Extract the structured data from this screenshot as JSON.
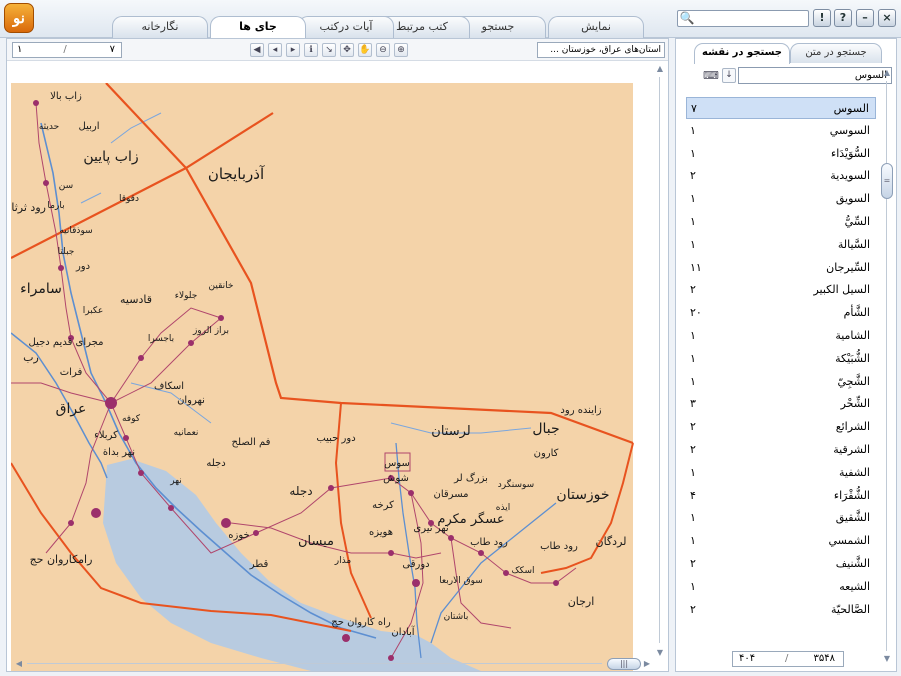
{
  "tabs": [
    {
      "label": "نمایش",
      "active": false
    },
    {
      "label": "جستجو",
      "active": false
    },
    {
      "label": "کتب مرتبط",
      "active": false
    },
    {
      "label": "آیات درکتب",
      "active": false
    },
    {
      "label": "جای ها",
      "active": true
    },
    {
      "label": "نگارخانه",
      "active": false
    }
  ],
  "window_buttons": {
    "help": "?",
    "alert": "!",
    "minimize": "–",
    "close": "×"
  },
  "search": {
    "placeholder": ""
  },
  "map_toolbar": {
    "page_current": "۱",
    "page_sep": "/",
    "page_total": "۷",
    "location": "استان‌های عراق، خوزستان ..."
  },
  "map_labels": {
    "azerbaijan": "آذربایجان",
    "zab_bala": "زاب بالا",
    "arbil": "اربیل",
    "haditha": "حدیثه",
    "zab_payin": "زاب پایین",
    "daqouqa": "دقوقا",
    "sen": "سن",
    "barima": "بارما",
    "rud_tharthar": "رود ثرثار",
    "sudaqaniyeh": "سوذقانیه",
    "jabala": "جبلتا",
    "dour": "دور",
    "samarra": "سامراء",
    "qadisiyah": "قادسیه",
    "jalula": "جلولاء",
    "khaniqin": "خانقین",
    "ukbara": "عکبرا",
    "baraz_alruz": "براز الروز",
    "bajisra": "باجسرا",
    "dojayl": "مجرای قدیم دجیل",
    "rab": "رب",
    "farat": "فرات",
    "iskaf": "اسکاف",
    "nahrawan": "نهروان",
    "iraq": "عراق",
    "kufa": "کوفه",
    "nomaniyeh": "نعمانیه",
    "karbala": "کربلاء",
    "nahr_badat": "نهر بداة",
    "nahr": "نهر",
    "fam_alsolh": "فم الصلح",
    "dijleh_a": "دجله",
    "dijleh_b": "دجله",
    "dour_habib": "دور حبیب",
    "luristan": "لرستان",
    "jibal": "جبال",
    "zayandeh": "زاینده رود",
    "karun": "کارون",
    "shush": "شوش",
    "bozorg_lor": "بزرگ لر",
    "susangerd": "سوسنگرد",
    "masrqan": "مسرقان",
    "khuzestan": "خوزستان",
    "izeh": "ایذه",
    "karkheh": "کرخه",
    "askar_mokram": "عسگر مکرم",
    "nahr_tiri": "نهر تیری",
    "huwaizeh": "هویزه",
    "ramhormoz": "رود طاب",
    "arjan": "ارجان",
    "dorgan": "لردگان",
    "rud_tab": "رود طاب",
    "raman": "رامکاروان حج",
    "maysan": "میسان",
    "khwaz": "خوزه",
    "qatar": "قطر",
    "mazar": "مذار",
    "abadan": "آبادان",
    "basht": "باشتان",
    "suq_alahwaz": "سوق الاربعا",
    "dorqi": "دورقی",
    "askak": "اسکک",
    "tarq": "راه کاروان حج",
    "sous": "سوس"
  },
  "side_panel": {
    "tab_text": "جستجو در متن",
    "tab_map": "جستجو در نقشه",
    "search_value": "السوس",
    "results": [
      {
        "name": "السوس",
        "count": "۷",
        "selected": true
      },
      {
        "name": "السوسي",
        "count": "۱",
        "selected": false
      },
      {
        "name": "السُّوَيْدَاء",
        "count": "۱",
        "selected": false
      },
      {
        "name": "السويدية",
        "count": "۲",
        "selected": false
      },
      {
        "name": "السويق",
        "count": "۱",
        "selected": false
      },
      {
        "name": "السِّيُّ",
        "count": "۱",
        "selected": false
      },
      {
        "name": "السَّيالة",
        "count": "۱",
        "selected": false
      },
      {
        "name": "السِّيرجان",
        "count": "۱۱",
        "selected": false
      },
      {
        "name": "السيل الكبير",
        "count": "۲",
        "selected": false
      },
      {
        "name": "الشَّأم",
        "count": "۲۰",
        "selected": false
      },
      {
        "name": "الشامية",
        "count": "۱",
        "selected": false
      },
      {
        "name": "الشُّبَيْكة",
        "count": "۱",
        "selected": false
      },
      {
        "name": "الشَّجِيّ",
        "count": "۱",
        "selected": false
      },
      {
        "name": "الشِّحْر",
        "count": "۳",
        "selected": false
      },
      {
        "name": "الشرائع",
        "count": "۲",
        "selected": false
      },
      {
        "name": "الشرقية",
        "count": "۲",
        "selected": false
      },
      {
        "name": "الشفية",
        "count": "۱",
        "selected": false
      },
      {
        "name": "الشُّقْرَاء",
        "count": "۴",
        "selected": false
      },
      {
        "name": "الشَّقيق",
        "count": "۱",
        "selected": false
      },
      {
        "name": "الشمسي",
        "count": "۱",
        "selected": false
      },
      {
        "name": "الشَّنيف",
        "count": "۲",
        "selected": false
      },
      {
        "name": "الشيعه",
        "count": "۱",
        "selected": false
      },
      {
        "name": "الصَّالحيّة",
        "count": "۲",
        "selected": false
      }
    ],
    "status_left": "۴۰۴",
    "status_sep": "/",
    "status_right": "۳۵۴۸"
  },
  "colors": {
    "land": "#f4d3a9",
    "water": "#b8cbe0",
    "river": "#5d8fd1",
    "border": "#e8531f",
    "route": "#b0466c",
    "node": "#9b2f6b",
    "selection": "#cfe0f6"
  }
}
